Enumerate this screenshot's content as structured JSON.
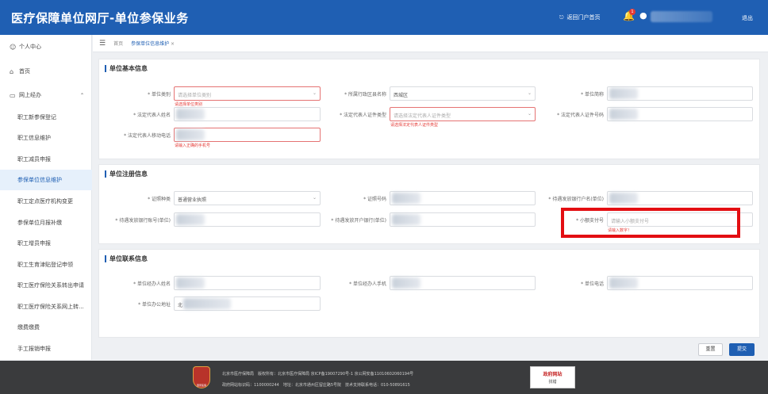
{
  "header": {
    "title": "医疗保障单位网厅-单位参保业务",
    "portal_link": "返回门户首页",
    "notification_count": "1",
    "logout": "退出"
  },
  "sidebar": {
    "items": [
      {
        "label": "个人中心",
        "icon": "user-icon"
      },
      {
        "label": "首页",
        "icon": "home-icon"
      },
      {
        "label": "网上经办",
        "icon": "folder-icon"
      },
      {
        "label": "职工新参保登记"
      },
      {
        "label": "职工信息维护"
      },
      {
        "label": "职工减员申报"
      },
      {
        "label": "参保单位信息维护"
      },
      {
        "label": "职工定点医疗机构变更"
      },
      {
        "label": "参保单位月报补缴"
      },
      {
        "label": "职工增员申报"
      },
      {
        "label": "职工生育津贴登记申领"
      },
      {
        "label": "职工医疗保险关系转出申请"
      },
      {
        "label": "职工医疗保险关系网上转..."
      },
      {
        "label": "缴费缴费"
      },
      {
        "label": "手工报销申报"
      }
    ]
  },
  "breadcrumb": {
    "home": "首页",
    "current": "参保单位信息维护",
    "close": "×"
  },
  "sections": {
    "basic": {
      "title": "单位基本信息",
      "unit_type_label": "* 单位类别",
      "unit_type_placeholder": "请选择单位类别",
      "unit_type_error": "请选择单位类别",
      "district_label": "* 所属行政区县名称",
      "district_value": "西城区",
      "short_name_label": "* 单位简称",
      "legal_name_label": "* 法定代表人姓名",
      "legal_id_type_label": "* 法定代表人证件类型",
      "legal_id_type_placeholder": "请选择法定代表人证件类型",
      "legal_id_type_error": "请选择法定代表人证件类型",
      "legal_id_no_label": "* 法定代表人证件号码",
      "legal_phone_label": "* 法定代表人移动电话",
      "legal_phone_error": "请输入正确的手机号"
    },
    "register": {
      "title": "单位注册信息",
      "cert_type_label": "* 证照种类",
      "cert_type_value": "普通营业执照",
      "cert_no_label": "* 证照号码",
      "bank_name_label": "* 待遇发放银行户名(单位)",
      "bank_acct_label": "* 待遇发放银行账号(单位)",
      "bank_branch_label": "* 待遇发放开户银行(单位)",
      "small_pay_label": "* 小额支付号",
      "small_pay_placeholder": "请输入小额支付号",
      "small_pay_error": "请输入数字！"
    },
    "contact": {
      "title": "单位联系信息",
      "agent_name_label": "* 单位经办人姓名",
      "agent_phone_label": "* 单位经办人手机",
      "unit_phone_label": "* 单位电话",
      "office_addr_label": "* 单位办公地址",
      "office_addr_prefix": "北"
    }
  },
  "actions": {
    "reset": "重置",
    "submit": "提交"
  },
  "footer": {
    "emblem_text": "国家医保",
    "line1": "北京市医疗保障局　版权所有：北京市医疗保障局 京ICP备19007290号-1 京公网安备11010602060194号",
    "line2": "政府网站标识码：1100000244　地址：北京市通州区留庄路5号院　技术支持联系电话：010-50891615",
    "gov_title": "政府网站",
    "gov_sub": "找错"
  },
  "colors": {
    "primary": "#1f5fb3",
    "highlight": "#e30e12",
    "error": "#e53935",
    "footer_bg": "#3a3b3d"
  }
}
